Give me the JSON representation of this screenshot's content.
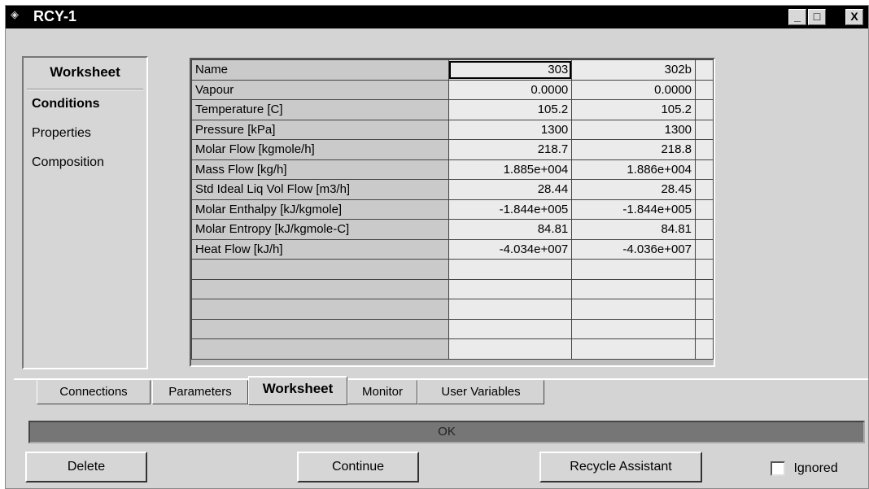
{
  "window": {
    "title": "RCY-1",
    "minimize": "_",
    "maximize": "□",
    "close": "X"
  },
  "sidebar": {
    "heading": "Worksheet",
    "items": [
      {
        "label": "Conditions",
        "active": true
      },
      {
        "label": "Properties",
        "active": false
      },
      {
        "label": "Composition",
        "active": false
      }
    ]
  },
  "grid": {
    "header": {
      "label": "Name",
      "col1": "303",
      "col2": "302b"
    },
    "rows": [
      {
        "label": "Vapour",
        "col1": "0.0000",
        "col2": "0.0000"
      },
      {
        "label": "Temperature [C]",
        "col1": "105.2",
        "col2": "105.2"
      },
      {
        "label": "Pressure [kPa]",
        "col1": "1300",
        "col2": "1300"
      },
      {
        "label": "Molar Flow [kgmole/h]",
        "col1": "218.7",
        "col2": "218.8"
      },
      {
        "label": "Mass Flow [kg/h]",
        "col1": "1.885e+004",
        "col2": "1.886e+004"
      },
      {
        "label": "Std Ideal Liq Vol Flow [m3/h]",
        "col1": "28.44",
        "col2": "28.45"
      },
      {
        "label": "Molar Enthalpy [kJ/kgmole]",
        "col1": "-1.844e+005",
        "col2": "-1.844e+005"
      },
      {
        "label": "Molar Entropy [kJ/kgmole-C]",
        "col1": "84.81",
        "col2": "84.81"
      },
      {
        "label": "Heat Flow [kJ/h]",
        "col1": "-4.034e+007",
        "col2": "-4.036e+007"
      }
    ]
  },
  "tabs": [
    {
      "label": "Connections",
      "active": false
    },
    {
      "label": "Parameters",
      "active": false
    },
    {
      "label": "Worksheet",
      "active": true
    },
    {
      "label": "Monitor",
      "active": false
    },
    {
      "label": "User Variables",
      "active": false
    }
  ],
  "status": {
    "text": "OK"
  },
  "buttons": {
    "delete": "Delete",
    "continue": "Continue",
    "recycle_assistant": "Recycle Assistant",
    "ignored": "Ignored"
  },
  "ignored_checked": false
}
